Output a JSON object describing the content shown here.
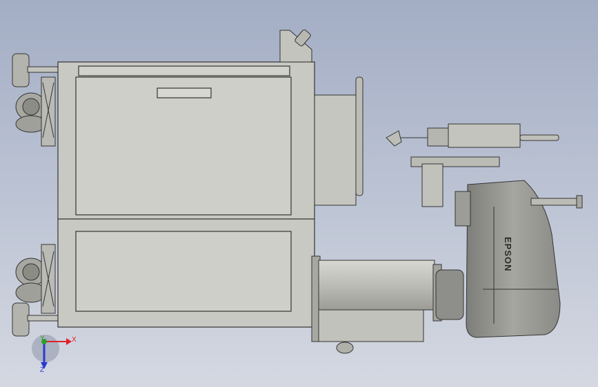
{
  "model": {
    "brand_label": "EPSON",
    "body_color": "#c9c9c3",
    "panel_color": "#cfcfc9",
    "robot_color": "#9a9a96",
    "outline_color": "#333333"
  },
  "triad": {
    "x_label": "X",
    "y_label": "Y",
    "z_label": "Z",
    "x_color": "#e0202a",
    "y_color": "#2aa02a",
    "z_color": "#2a3ad0"
  }
}
